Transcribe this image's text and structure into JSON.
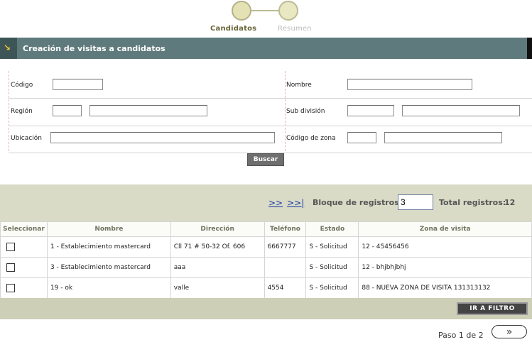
{
  "stepper": {
    "steps": [
      {
        "label": "Candidatos",
        "active": true
      },
      {
        "label": "Resumen",
        "active": false
      }
    ]
  },
  "header": {
    "title": "Creación de visitas a candidatos",
    "icon": "arrow-down-right-icon"
  },
  "form": {
    "codigo_label": "Código",
    "nombre_label": "Nombre",
    "region_label": "Región",
    "subdivision_label": "Sub división",
    "ubicacion_label": "Ubicación",
    "codigo_zona_label": "Código de zona",
    "buscar_label": "Buscar"
  },
  "results": {
    "next_link": ">>",
    "last_link": ">>|",
    "bloque_label": "Bloque de registros:",
    "bloque_value": "3",
    "total_label": "Total registros:",
    "total_value": "12"
  },
  "table": {
    "headers": [
      "Seleccionar",
      "Nombre",
      "Dirección",
      "Teléfono",
      "Estado",
      "Zona de visita"
    ],
    "rows": [
      {
        "nombre": "1 - Establecimiento mastercard",
        "direccion": "Cll 71 # 50-32 Of. 606",
        "telefono": "6667777",
        "estado": "S - Solicitud",
        "zona": "12 - 45456456"
      },
      {
        "nombre": "3 - Establecimiento mastercard",
        "direccion": "aaa",
        "telefono": "",
        "estado": "S - Solicitud",
        "zona": "12 - bhjbhjbhj"
      },
      {
        "nombre": "19 - ok",
        "direccion": "valle",
        "telefono": "4554",
        "estado": "S - Solicitud",
        "zona": "88 - NUEVA ZONA DE VISITA 131313132"
      }
    ]
  },
  "footer": {
    "filtro_label": "IR A FILTRO",
    "paso_text": "Paso 1 de 2",
    "next_icon": "double-chevron-right-icon"
  },
  "colors": {
    "header_bg": "#5f7a7c",
    "results_bg": "#d9dbc6",
    "accent": "#f1c332"
  }
}
